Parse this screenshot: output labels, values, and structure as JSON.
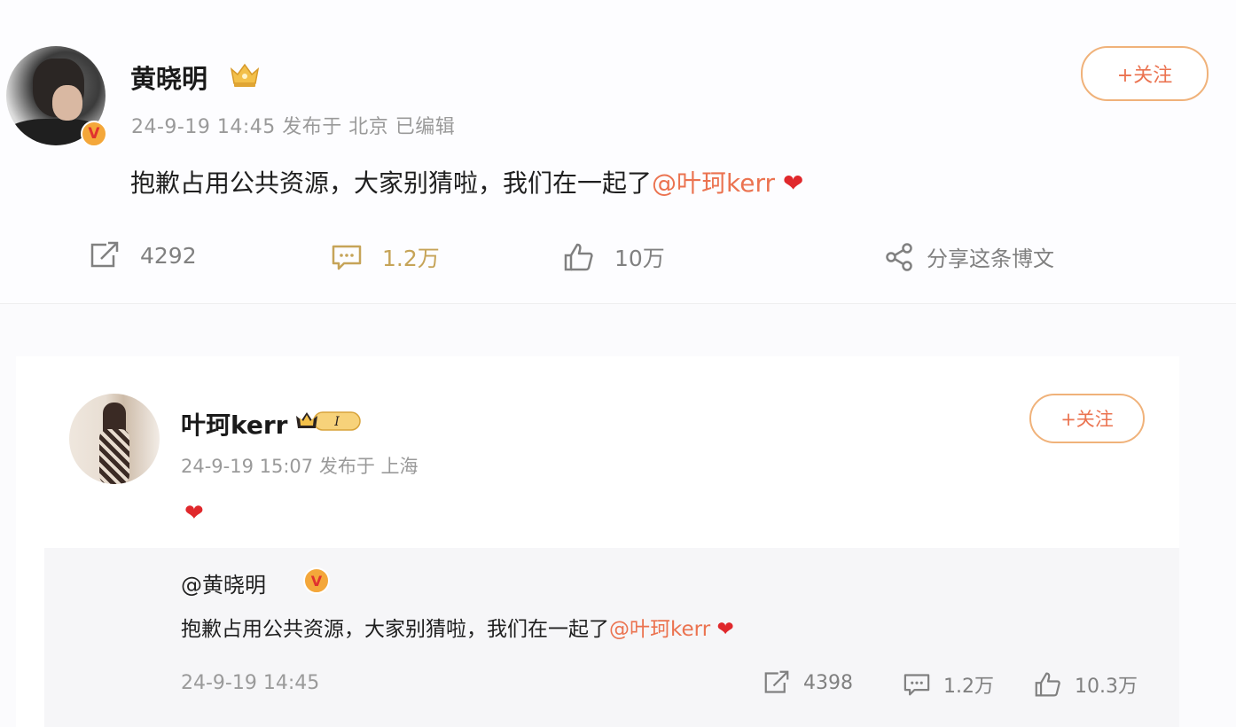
{
  "post1": {
    "author": "黄晓明",
    "verified_badge": "V",
    "follow_label": "+关注",
    "meta": "24-9-19 14:45  发布于 北京   已编辑",
    "content_text": "抱歉占用公共资源，大家别猜啦，我们在一起了",
    "mention": "@叶珂kerr",
    "heart": "❤",
    "actions": {
      "repost_count": "4292",
      "comment_count": "1.2万",
      "like_count": "10万",
      "share_label": "分享这条博文"
    }
  },
  "post2": {
    "author": "叶珂kerr",
    "vip_level": "I",
    "follow_label": "+关注",
    "meta": "24-9-19 15:07  发布于 上海",
    "heart": "❤",
    "quoted": {
      "author": "@黄晓明",
      "verified_badge": "V",
      "content_text": "抱歉占用公共资源，大家别猜啦，我们在一起了",
      "mention": "@叶珂kerr",
      "heart": "❤",
      "time": "24-9-19 14:45",
      "repost_count": "4398",
      "comment_count": "1.2万",
      "like_count": "10.3万"
    }
  },
  "colors": {
    "mention": "#eb7350",
    "heart": "#e0282c",
    "follow_border": "#f0b27a",
    "meta_gray": "#9a9a9a",
    "badge_orange": "#f4a73a"
  }
}
